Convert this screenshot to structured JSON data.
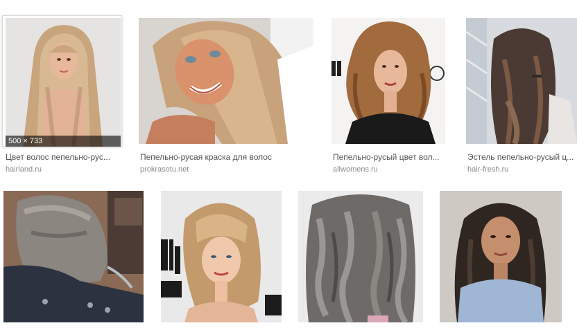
{
  "results_row1": [
    {
      "caption": "Цвет волос пепельно-рус...",
      "source": "hairland.ru",
      "dimensions": "500 × 733",
      "selected": true
    },
    {
      "caption": "Пепельно-русая краска для волос",
      "source": "prokrasotu.net"
    },
    {
      "caption": "Пепельно-русый цвет вол...",
      "source": "allwomens.ru"
    },
    {
      "caption": "Эстель пепельно-русый ц...",
      "source": "hair-fresh.ru"
    }
  ],
  "results_row2": [
    {
      "caption": ""
    },
    {
      "caption": ""
    },
    {
      "caption": ""
    },
    {
      "caption": ""
    }
  ],
  "colors": {
    "caption_text": "#555555",
    "source_text": "#8c8c8c",
    "dims_overlay": "rgba(0,0,0,0.6)"
  }
}
